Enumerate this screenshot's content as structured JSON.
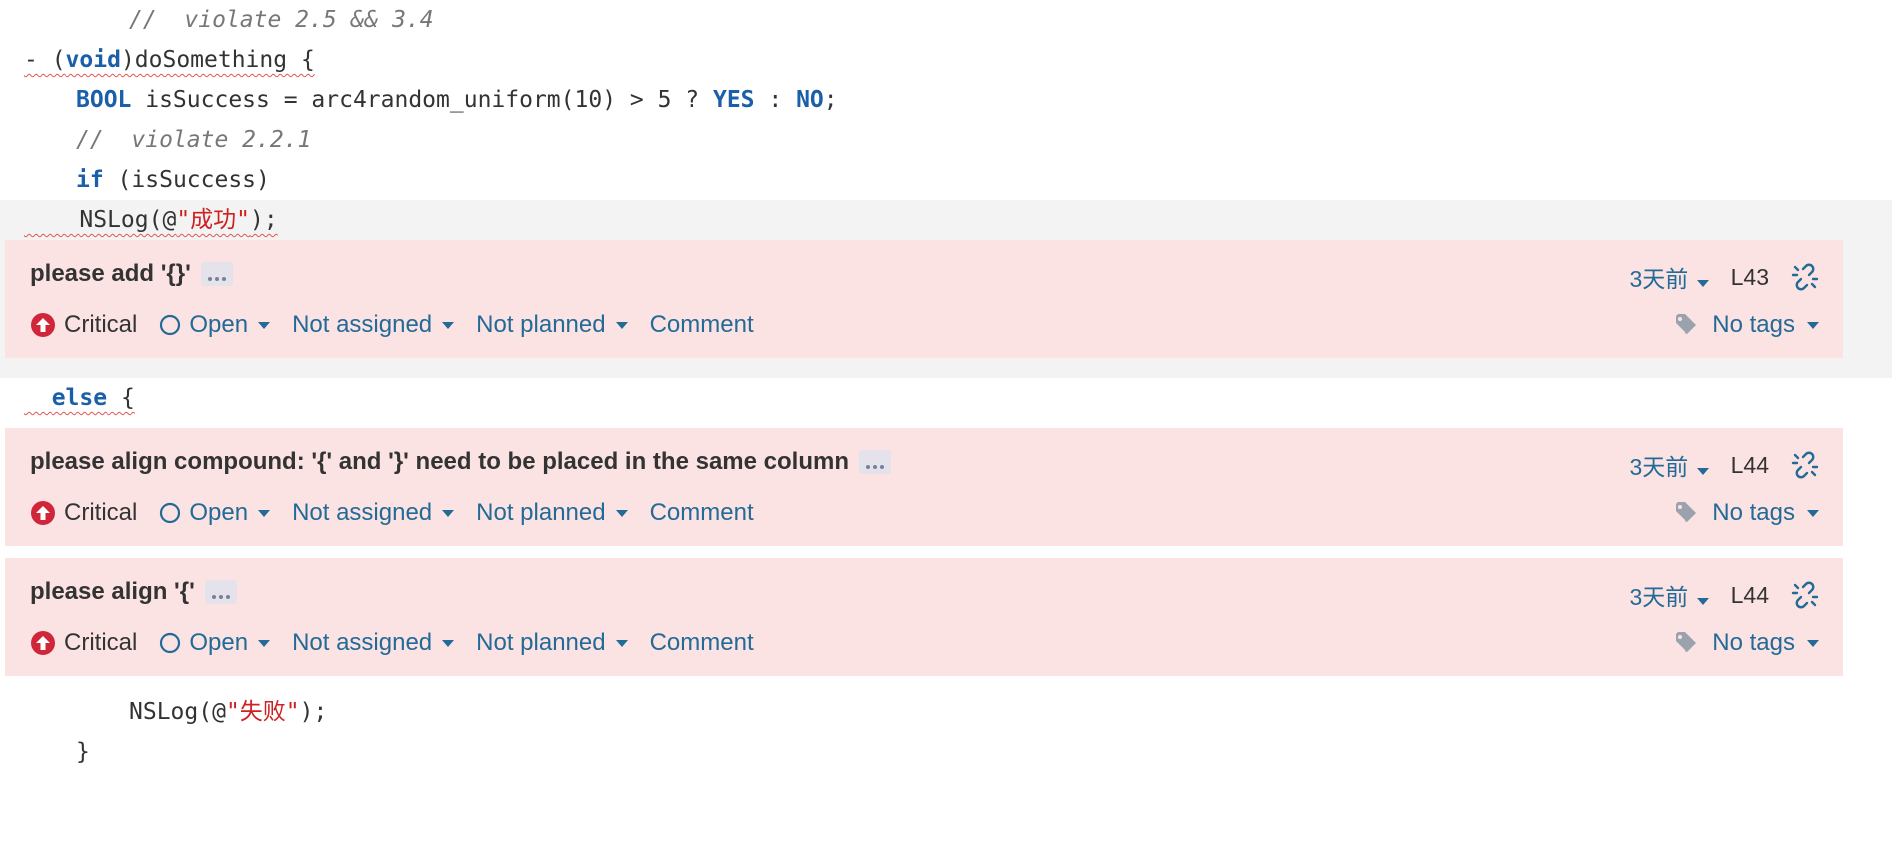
{
  "code": {
    "comment1": "//  violate 2.5 && 3.4",
    "dash": "- (",
    "void_kw": "void",
    "method_sig": ")doSomething {",
    "bool_kw": "BOOL",
    "assign_expr": " isSuccess = arc4random_uniform(10) > 5 ? ",
    "yes_kw": "YES",
    "colon": " : ",
    "no_kw": "NO",
    "semicolon": ";",
    "comment2": "//  violate 2.2.1",
    "if_kw": "if",
    "if_cond": " (isSuccess)",
    "nslog_prefix": "NSLog(@",
    "str_success": "\"成功\"",
    "nslog_suffix": ");",
    "else_kw": "else",
    "else_brace": " {",
    "str_fail": "\"失败\"",
    "close_brace": "}"
  },
  "issues": [
    {
      "title": "please add '{}'",
      "severity": "Critical",
      "status": "Open",
      "assignee": "Not assigned",
      "plan": "Not planned",
      "comment": "Comment",
      "age": "3天前",
      "line": "L43",
      "tags": "No tags"
    },
    {
      "title": "please align compound: '{' and '}' need to be placed in the same column",
      "severity": "Critical",
      "status": "Open",
      "assignee": "Not assigned",
      "plan": "Not planned",
      "comment": "Comment",
      "age": "3天前",
      "line": "L44",
      "tags": "No tags"
    },
    {
      "title": "please align '{'",
      "severity": "Critical",
      "status": "Open",
      "assignee": "Not assigned",
      "plan": "Not planned",
      "comment": "Comment",
      "age": "3天前",
      "line": "L44",
      "tags": "No tags"
    }
  ],
  "colors": {
    "issue_bg": "#fbe3e3",
    "highlight_bg": "#f3f3f3",
    "keyword": "#1a5fa8",
    "string": "#cc2222",
    "link": "#236a97",
    "critical": "#d0263a",
    "squiggle": "#e05555"
  },
  "icons": {
    "severity": "critical-arrow-up-icon",
    "status": "open-circle-icon",
    "dropdown": "caret-down-icon",
    "link": "broken-link-icon",
    "tags": "tag-icon",
    "more": "ellipsis-icon"
  }
}
